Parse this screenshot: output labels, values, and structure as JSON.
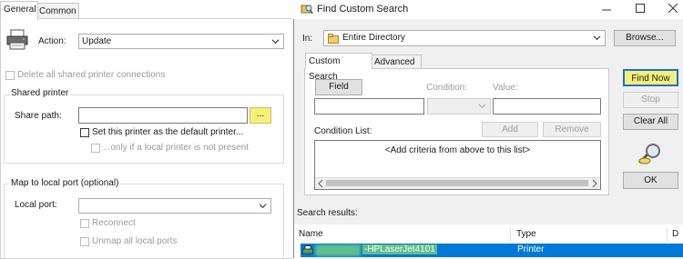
{
  "left": {
    "tabs": [
      "General",
      "Common"
    ],
    "action_label": "Action:",
    "action_value": "Update",
    "delete_all_label": "Delete all shared printer connections",
    "shared_printer_group": "Shared printer",
    "share_path_label": "Share path:",
    "share_path_value": "",
    "browse_button": "...",
    "default_printer_label": "Set this printer as the default printer...",
    "local_only_label": "...only if a local printer is not present",
    "map_group": "Map to local port (optional)",
    "local_port_label": "Local port:",
    "local_port_value": "",
    "reconnect_label": "Reconnect",
    "unmap_label": "Unmap all local ports"
  },
  "dialog": {
    "title": "Find Custom Search",
    "in_label": "In:",
    "in_value": "Entire Directory",
    "browse_button": "Browse...",
    "tabs": [
      "Custom Search",
      "Advanced"
    ],
    "field_button": "Field",
    "condition_label": "Condition:",
    "value_label": "Value:",
    "add_button": "Add",
    "remove_button": "Remove",
    "condition_list_label": "Condition List:",
    "condition_list_placeholder": "<Add criteria from above to this list>",
    "find_now_button": "Find Now",
    "stop_button": "Stop",
    "clear_all_button": "Clear All",
    "ok_button": "OK",
    "search_results_label": "Search results:",
    "columns": [
      "Name",
      "Type",
      "D"
    ],
    "results": [
      {
        "name": "-HPLaserJet4101",
        "type": "Printer"
      }
    ]
  },
  "colors": {
    "highlight_yellow": "#f5f07a",
    "selection_blue": "#0078d7",
    "window_bg": "#f0f0f0"
  }
}
